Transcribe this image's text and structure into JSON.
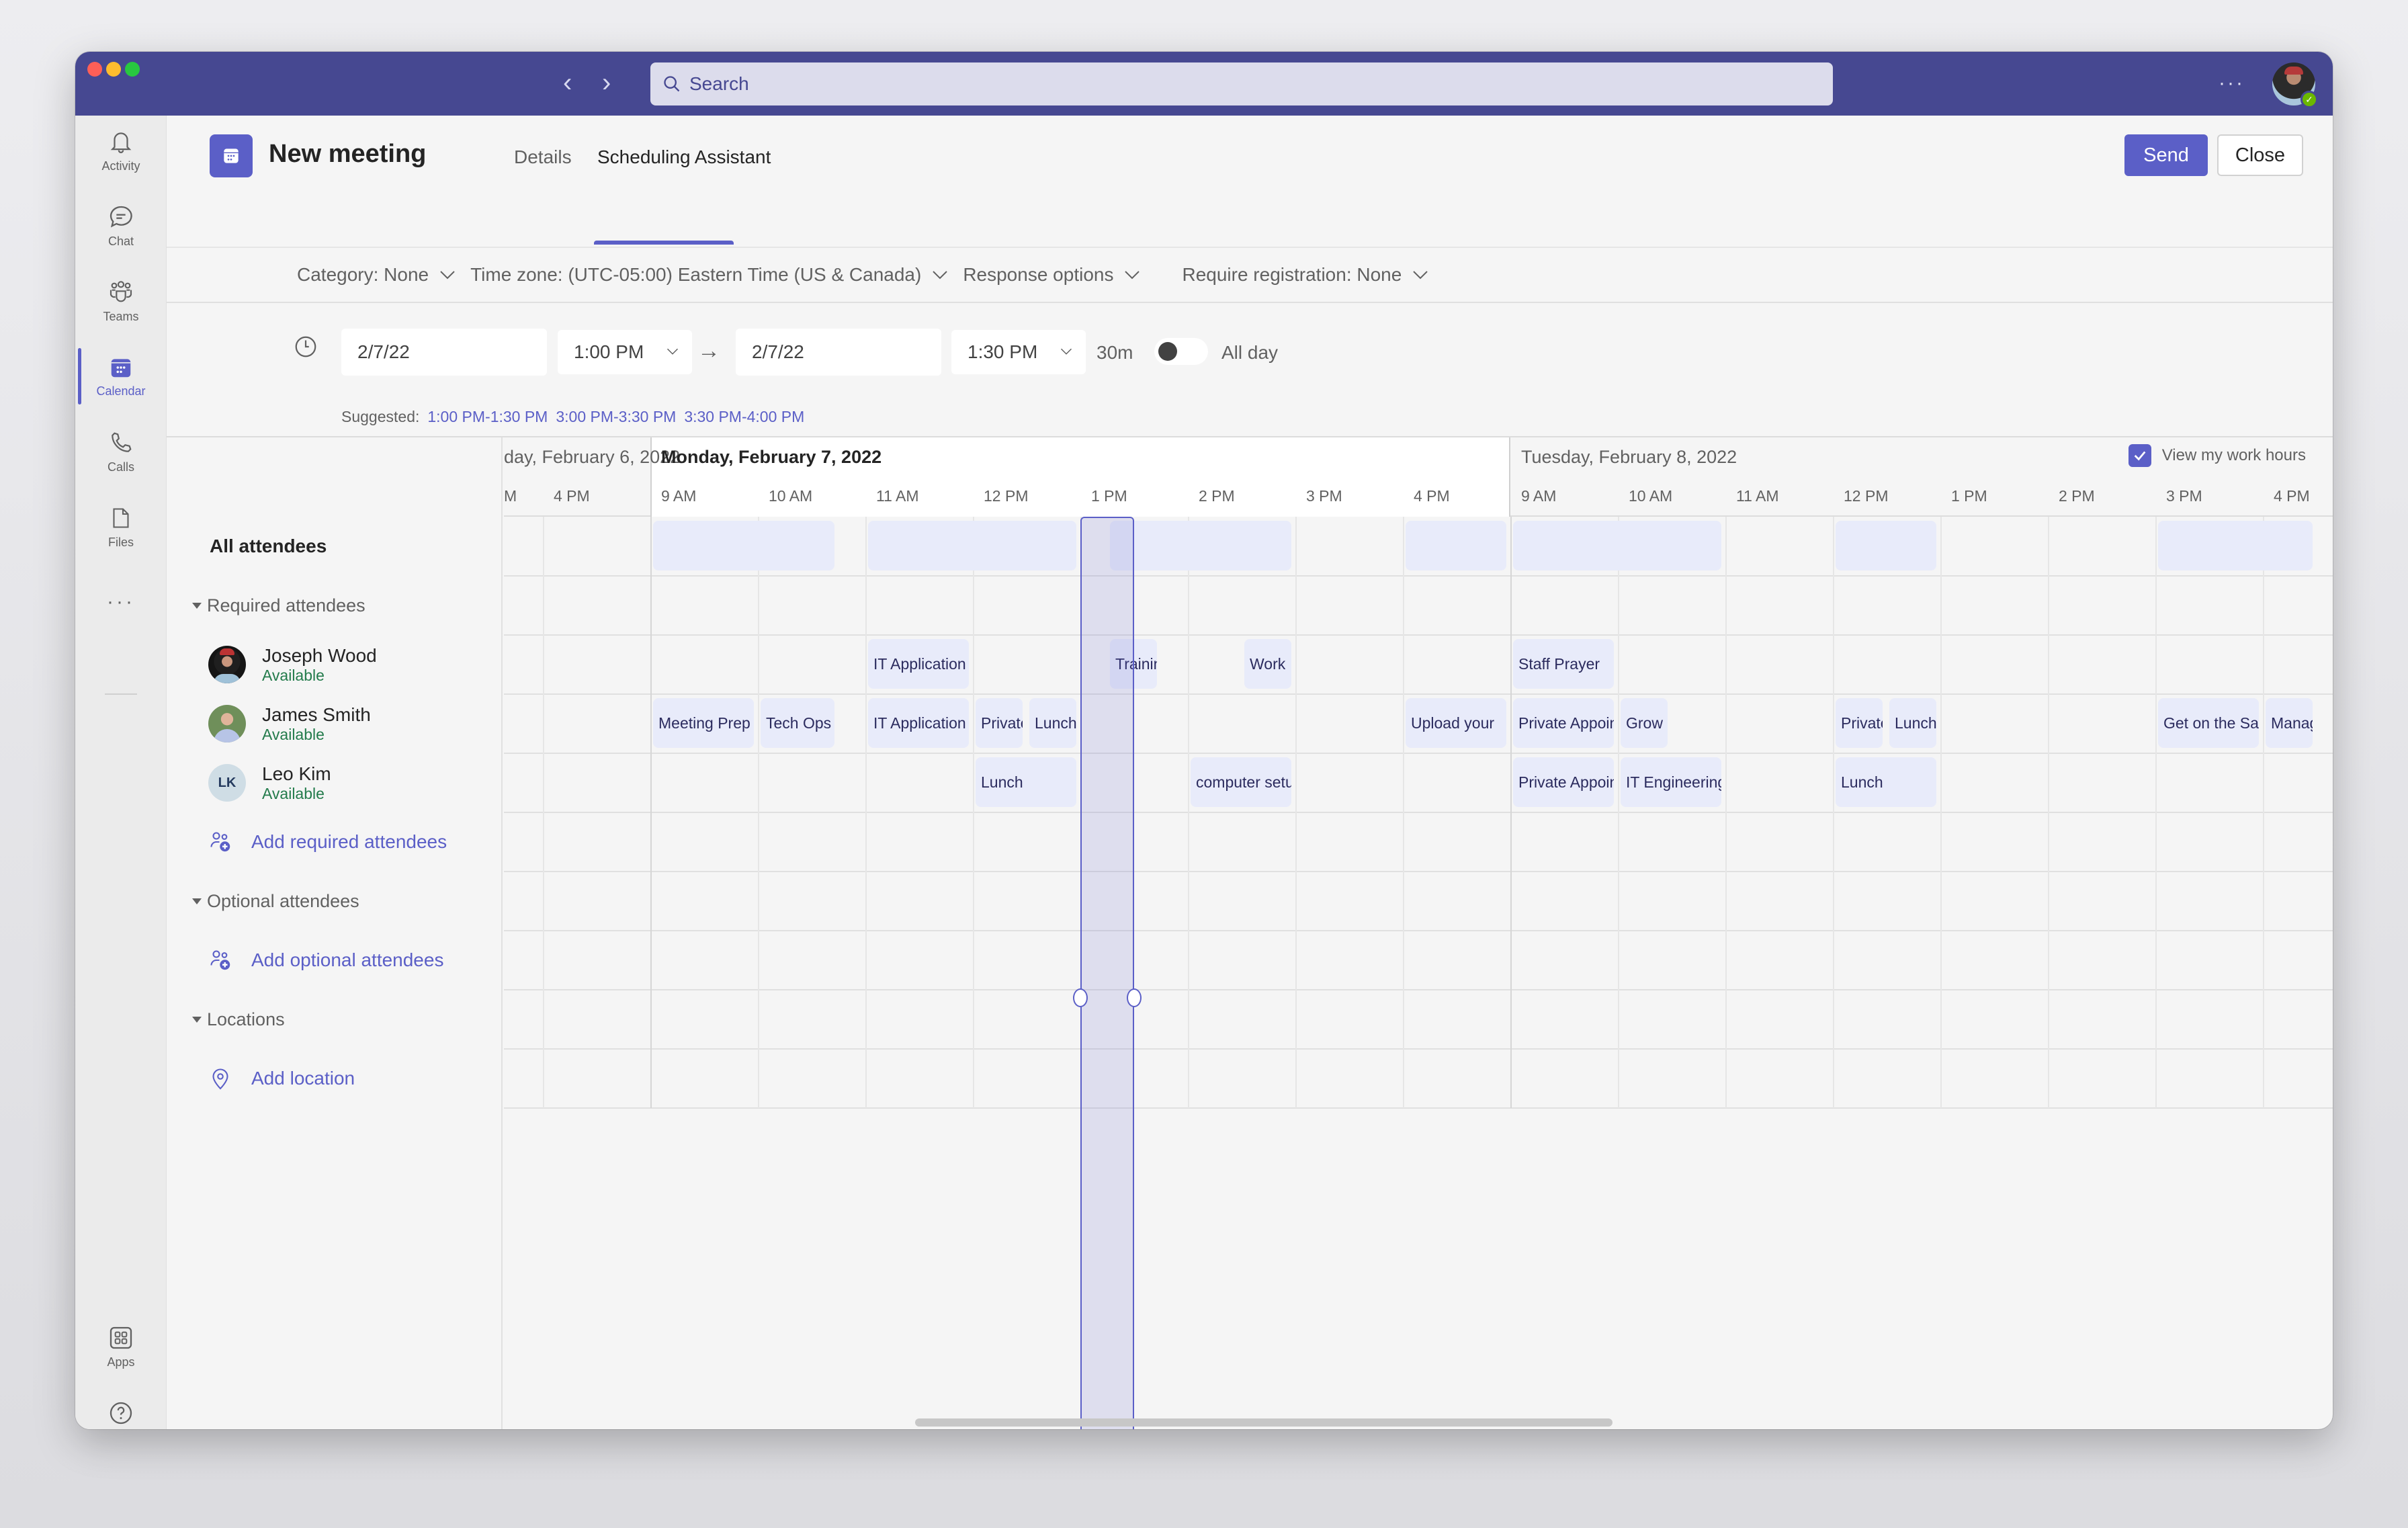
{
  "titlebar": {
    "search_placeholder": "Search",
    "more_label": "···"
  },
  "rail": {
    "items": [
      {
        "label": "Activity",
        "icon": "bell-icon"
      },
      {
        "label": "Chat",
        "icon": "chat-icon"
      },
      {
        "label": "Teams",
        "icon": "teams-icon"
      },
      {
        "label": "Calendar",
        "icon": "calendar-icon",
        "active": true
      },
      {
        "label": "Calls",
        "icon": "phone-icon"
      },
      {
        "label": "Files",
        "icon": "file-icon"
      },
      {
        "label": "···",
        "icon": "more-icon"
      }
    ],
    "bottom": [
      {
        "label": "Apps",
        "icon": "apps-icon"
      },
      {
        "label": "Help",
        "icon": "help-icon"
      }
    ]
  },
  "header": {
    "title": "New meeting",
    "tabs": [
      {
        "label": "Details",
        "active": false
      },
      {
        "label": "Scheduling Assistant",
        "active": true
      }
    ],
    "send_label": "Send",
    "close_label": "Close"
  },
  "options": {
    "category": "Category: None",
    "timezone": "Time zone: (UTC-05:00) Eastern Time (US & Canada)",
    "response": "Response options",
    "registration": "Require registration: None"
  },
  "datetime": {
    "start_date": "2/7/22",
    "start_time": "1:00 PM",
    "end_date": "2/7/22",
    "end_time": "1:30 PM",
    "duration": "30m",
    "all_day_label": "All day",
    "all_day": false,
    "suggested_label": "Suggested:",
    "suggestions": [
      "1:00 PM-1:30 PM",
      "3:00 PM-3:30 PM",
      "3:30 PM-4:00 PM"
    ],
    "work_hours_label": "View my work hours",
    "work_hours_checked": true
  },
  "attendees": {
    "all_label": "All attendees",
    "required_label": "Required attendees",
    "people": [
      {
        "name": "Joseph Wood",
        "status": "Available",
        "initials": ""
      },
      {
        "name": "James Smith",
        "status": "Available",
        "initials": ""
      },
      {
        "name": "Leo Kim",
        "status": "Available",
        "initials": "LK"
      }
    ],
    "add_required": "Add required attendees",
    "optional_label": "Optional attendees",
    "add_optional": "Add optional attendees",
    "locations_label": "Locations",
    "add_location": "Add location"
  },
  "timeline": {
    "days": [
      {
        "label": "day, February 6, 2022",
        "today": false
      },
      {
        "label": "Monday, February 7, 2022",
        "today": true
      },
      {
        "label": "Tuesday, February 8, 2022",
        "today": false
      }
    ],
    "hours": [
      {
        "label": "M",
        "day": 0
      },
      {
        "label": "4 PM",
        "day": 0
      },
      {
        "label": "9 AM",
        "day": 1
      },
      {
        "label": "10 AM",
        "day": 1
      },
      {
        "label": "11 AM",
        "day": 1
      },
      {
        "label": "12 PM",
        "day": 1
      },
      {
        "label": "1 PM",
        "day": 1
      },
      {
        "label": "2 PM",
        "day": 1
      },
      {
        "label": "3 PM",
        "day": 1
      },
      {
        "label": "4 PM",
        "day": 1
      },
      {
        "label": "9 AM",
        "day": 2
      },
      {
        "label": "10 AM",
        "day": 2
      },
      {
        "label": "11 AM",
        "day": 2
      },
      {
        "label": "12 PM",
        "day": 2
      },
      {
        "label": "1 PM",
        "day": 2
      },
      {
        "label": "2 PM",
        "day": 2
      },
      {
        "label": "3 PM",
        "day": 2
      },
      {
        "label": "4 PM",
        "day": 2
      }
    ],
    "events": [
      {
        "row": "all",
        "slot": 2.0,
        "len": 1.75,
        "title": ""
      },
      {
        "row": "all",
        "slot": 4.0,
        "len": 2.0,
        "title": ""
      },
      {
        "row": "all",
        "slot": 6.25,
        "len": 1.75,
        "title": ""
      },
      {
        "row": "all",
        "slot": 9.0,
        "len": 1.0,
        "title": ""
      },
      {
        "row": "all",
        "slot": 10.0,
        "len": 2.0,
        "title": ""
      },
      {
        "row": "all",
        "slot": 13.0,
        "len": 1.0,
        "title": ""
      },
      {
        "row": "all",
        "slot": 16.0,
        "len": 1.5,
        "title": ""
      },
      {
        "row": "joseph",
        "slot": 4.0,
        "len": 1.0,
        "title": "IT Application"
      },
      {
        "row": "joseph",
        "slot": 6.25,
        "len": 0.5,
        "title": "Training"
      },
      {
        "row": "joseph",
        "slot": 7.5,
        "len": 0.5,
        "title": "Work"
      },
      {
        "row": "joseph",
        "slot": 10.0,
        "len": 1.0,
        "title": "Staff Prayer"
      },
      {
        "row": "james",
        "slot": 2.0,
        "len": 1.0,
        "title": "Meeting Prep"
      },
      {
        "row": "james",
        "slot": 3.0,
        "len": 0.75,
        "title": "Tech Ops"
      },
      {
        "row": "james",
        "slot": 4.0,
        "len": 1.0,
        "title": "IT Application"
      },
      {
        "row": "james",
        "slot": 5.0,
        "len": 0.5,
        "title": "Private"
      },
      {
        "row": "james",
        "slot": 5.5,
        "len": 0.5,
        "title": "Lunch"
      },
      {
        "row": "james",
        "slot": 9.0,
        "len": 1.0,
        "title": "Upload your"
      },
      {
        "row": "james",
        "slot": 10.0,
        "len": 1.0,
        "title": "Private Appointment"
      },
      {
        "row": "james",
        "slot": 11.0,
        "len": 0.5,
        "title": "Grow"
      },
      {
        "row": "james",
        "slot": 13.0,
        "len": 0.5,
        "title": "Private"
      },
      {
        "row": "james",
        "slot": 13.5,
        "len": 0.5,
        "title": "Lunch"
      },
      {
        "row": "james",
        "slot": 16.0,
        "len": 1.0,
        "title": "Get on the Same"
      },
      {
        "row": "james",
        "slot": 17.0,
        "len": 0.5,
        "title": "Manage"
      },
      {
        "row": "leo",
        "slot": 5.0,
        "len": 1.0,
        "title": "Lunch"
      },
      {
        "row": "leo",
        "slot": 7.0,
        "len": 1.0,
        "title": "computer setup"
      },
      {
        "row": "leo",
        "slot": 10.0,
        "len": 1.0,
        "title": "Private Appointment"
      },
      {
        "row": "leo",
        "slot": 11.0,
        "len": 1.0,
        "title": "IT Engineering"
      },
      {
        "row": "leo",
        "slot": 13.0,
        "len": 1.0,
        "title": "Lunch"
      }
    ],
    "selection": {
      "start": "1:00 PM",
      "end": "1:30 PM",
      "day": "Monday, February 7, 2022"
    }
  },
  "colors": {
    "brand": "#5b5fc7",
    "titlebar": "#464891",
    "available": "#237b4b",
    "event_bg": "#e8ebfa"
  }
}
